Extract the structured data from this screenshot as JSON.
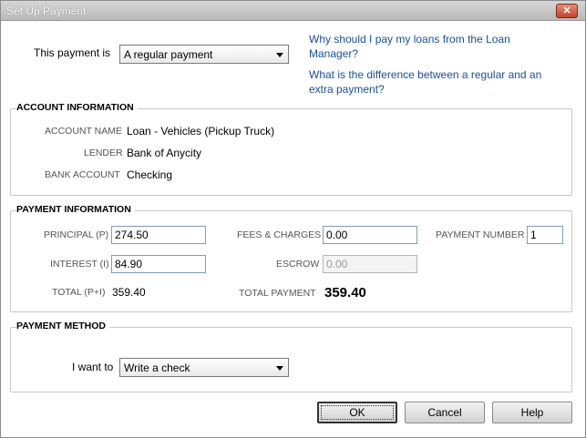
{
  "window": {
    "title": "Set Up Payment",
    "close_glyph": "✕"
  },
  "payment_type": {
    "label": "This payment is",
    "selected": "A regular payment"
  },
  "help_links": [
    "Why should I pay my loans from the Loan Manager?",
    "What is the difference between a regular and an extra payment?"
  ],
  "account_info": {
    "title": "ACCOUNT INFORMATION",
    "account_name_label": "ACCOUNT NAME",
    "account_name": "Loan - Vehicles (Pickup Truck)",
    "lender_label": "LENDER",
    "lender": "Bank of Anycity",
    "bank_account_label": "BANK ACCOUNT",
    "bank_account": "Checking"
  },
  "payment_info": {
    "title": "PAYMENT INFORMATION",
    "principal_label": "PRINCIPAL (P)",
    "principal": "274.50",
    "interest_label": "INTEREST (I)",
    "interest": "84.90",
    "total_label": "TOTAL (P+I)",
    "total": "359.40",
    "fees_label": "FEES & CHARGES",
    "fees": "0.00",
    "escrow_label": "ESCROW",
    "escrow": "0.00",
    "total_payment_label": "TOTAL PAYMENT",
    "total_payment": "359.40",
    "payment_number_label": "PAYMENT NUMBER",
    "payment_number": "1"
  },
  "payment_method": {
    "title": "PAYMENT METHOD",
    "label": "I want to",
    "selected": "Write a check"
  },
  "buttons": {
    "ok": "OK",
    "cancel": "Cancel",
    "help": "Help"
  }
}
